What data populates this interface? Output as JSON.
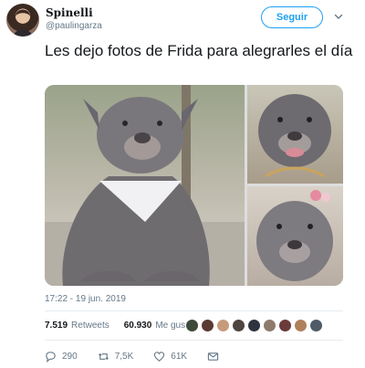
{
  "user": {
    "name": "Spinelli",
    "handle": "@paulingarza"
  },
  "follow_label": "Seguir",
  "tweet_text": "Les dejo fotos de Frida para alegrarles el día",
  "timestamp": "17:22 - 19 jun. 2019",
  "stats": {
    "retweets_count": "7.519",
    "retweets_label": "Retweets",
    "likes_count": "60.930",
    "likes_label": "Me gusta"
  },
  "actions": {
    "replies": "290",
    "retweets": "7,5K",
    "likes": "61K"
  },
  "colors": {
    "accent": "#1da1f2",
    "secondary_text": "#657786"
  }
}
